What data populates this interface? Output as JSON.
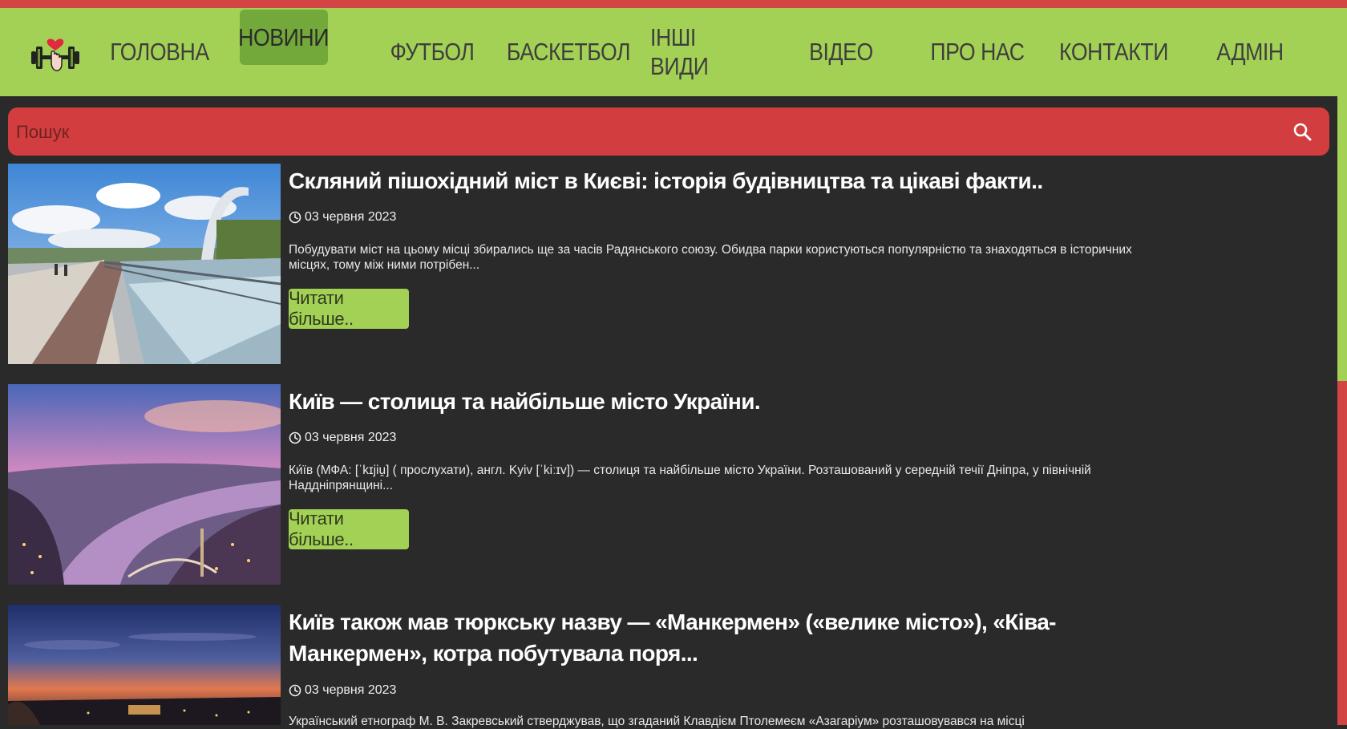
{
  "nav": {
    "items": [
      {
        "label": "ГОЛОВНА"
      },
      {
        "label": "НОВИНИ",
        "active": true
      },
      {
        "label": "ФУТБОЛ"
      },
      {
        "label": "БАСКЕТБОЛ"
      },
      {
        "label": "ІНШІ ВИДИ"
      },
      {
        "label": "ВІДЕО"
      },
      {
        "label": "ПРО НАС"
      },
      {
        "label": "КОНТАКТИ"
      },
      {
        "label": "АДМІН"
      }
    ]
  },
  "search": {
    "placeholder": "Пошук"
  },
  "articles": [
    {
      "title": "Скляний пішохідний міст в Києві: історія будівництва та цікаві факти..",
      "date": "03 червня 2023",
      "excerpt": "Побудувати міст на цьому місці збирались ще за часів Радянського союзу. Обидва парки користуються популярністю та знаходяться в історичних місцях, тому між ними потрібен...",
      "button": "Читати більше.."
    },
    {
      "title": "Київ — столиця та найбільше місто України.",
      "date": "03 червня 2023",
      "excerpt": "Ки́їв (МФА: [ˈkɪjiu̯] ( прослухати), англ. Kyiv [ˈkiːɪv]) — столиця та найбільше місто України. Розташований у середній течії Дніпра, у північній Наддніпрянщині...",
      "button": "Читати більше.."
    },
    {
      "title": "Київ також мав тюркську назву — «Манкермен» («велике місто»), «Ківа-Манкермен», котра побутувала поря...",
      "date": "03 червня 2023",
      "excerpt": "Український етнограф М. В. Закревський стверджував, що згаданий Клавдієм Птолемеєм «Азагаріум» розташовувався на місці"
    }
  ],
  "colors": {
    "accent_green": "#a3d155",
    "accent_red": "#d34545",
    "background": "#2a2a2a"
  }
}
